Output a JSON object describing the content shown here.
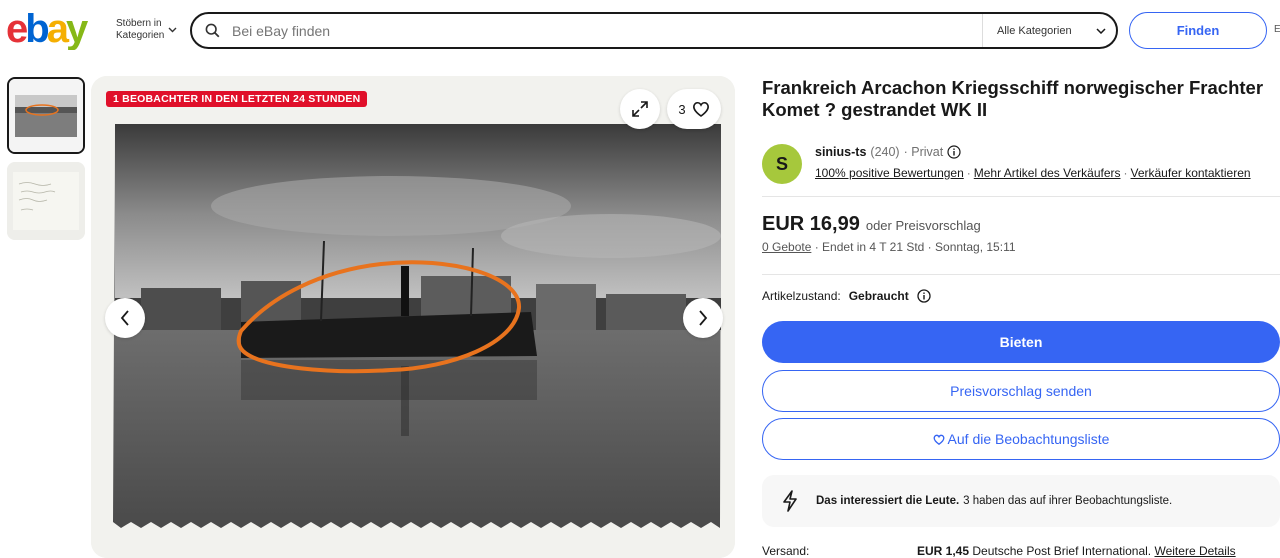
{
  "header": {
    "logo_letters": [
      "e",
      "b",
      "a",
      "y"
    ],
    "logo_colors": [
      "#e53238",
      "#0064d2",
      "#f5af02",
      "#86b817"
    ],
    "browse_label_line1": "Stöbern in",
    "browse_label_line2": "Kategorien",
    "search_placeholder": "Bei eBay finden",
    "category_select": "Alle Kategorien",
    "find_label": "Finden",
    "edge_fragment": "E"
  },
  "gallery": {
    "watch_badge": "1 BEOBACHTER IN DEN LETZTEN 24 STUNDEN",
    "watchers_count": "3",
    "icons": [
      "expand-icon",
      "heart-icon",
      "chevron-left-icon",
      "chevron-right-icon"
    ]
  },
  "listing": {
    "title": "Frankreich Arcachon Kriegsschiff norwegischer Frachter Komet ? gestrandet WK II",
    "seller": {
      "avatar_letter": "S",
      "name": "sinius-ts",
      "rating": "(240)",
      "type": "· Privat",
      "feedback_link": "100% positive Bewertungen",
      "more_items_link": "Mehr Artikel des Verkäufers",
      "contact_link": "Verkäufer kontaktieren"
    },
    "price": "EUR 16,99",
    "offer_text": "oder Preisvorschlag",
    "bids": "0 Gebote",
    "ends_in": "· Endet in 4 T 21 Std · Sonntag, 15:11",
    "condition_label": "Artikelzustand:",
    "condition_value": "Gebraucht",
    "bid_button": "Bieten",
    "offer_button": "Preisvorschlag senden",
    "watchlist_button": "Auf die Beobachtungsliste",
    "interest_bold": "Das interessiert die Leute.",
    "interest_text": "3 haben das auf ihrer Beobachtungsliste.",
    "shipping_label": "Versand:",
    "shipping_amount": "EUR 1,45",
    "shipping_method": "Deutsche Post Brief International.",
    "shipping_details_link": "Weitere Details"
  },
  "colors": {
    "accent": "#3665f3",
    "badge_red": "#e0102a",
    "avatar_green": "#a6c83c"
  }
}
